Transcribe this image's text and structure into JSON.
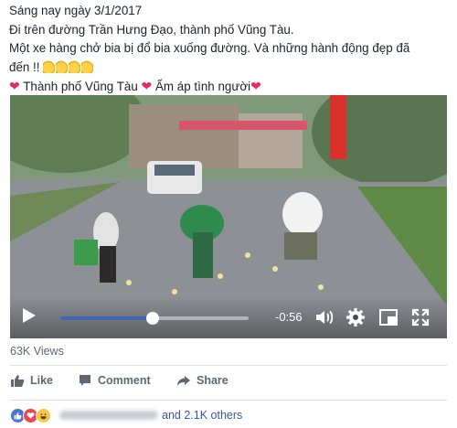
{
  "post": {
    "line1": "Sáng nay ngày 3/1/2017",
    "line2": "Đi trên đường Trần Hưng Đạo, thành phố Vũng Tàu.",
    "line3": "Một xe hàng chở bia bị đổ bia xuống đường. Và những hành động đẹp đã",
    "line4": "đến !!",
    "line5": "Thành phố Vũng Tàu",
    "line5b": "Ấm áp tình người",
    "heart": "❤"
  },
  "video": {
    "time": "-0:56",
    "progress_fraction": 0.49,
    "accent": "#4267b2"
  },
  "stats": {
    "views": "63K Views"
  },
  "actions": {
    "like": "Like",
    "comment": "Comment",
    "share": "Share"
  },
  "reactions": {
    "icons": [
      "like-icon",
      "love-icon",
      "haha-icon"
    ],
    "others": "and 2.1K others"
  }
}
